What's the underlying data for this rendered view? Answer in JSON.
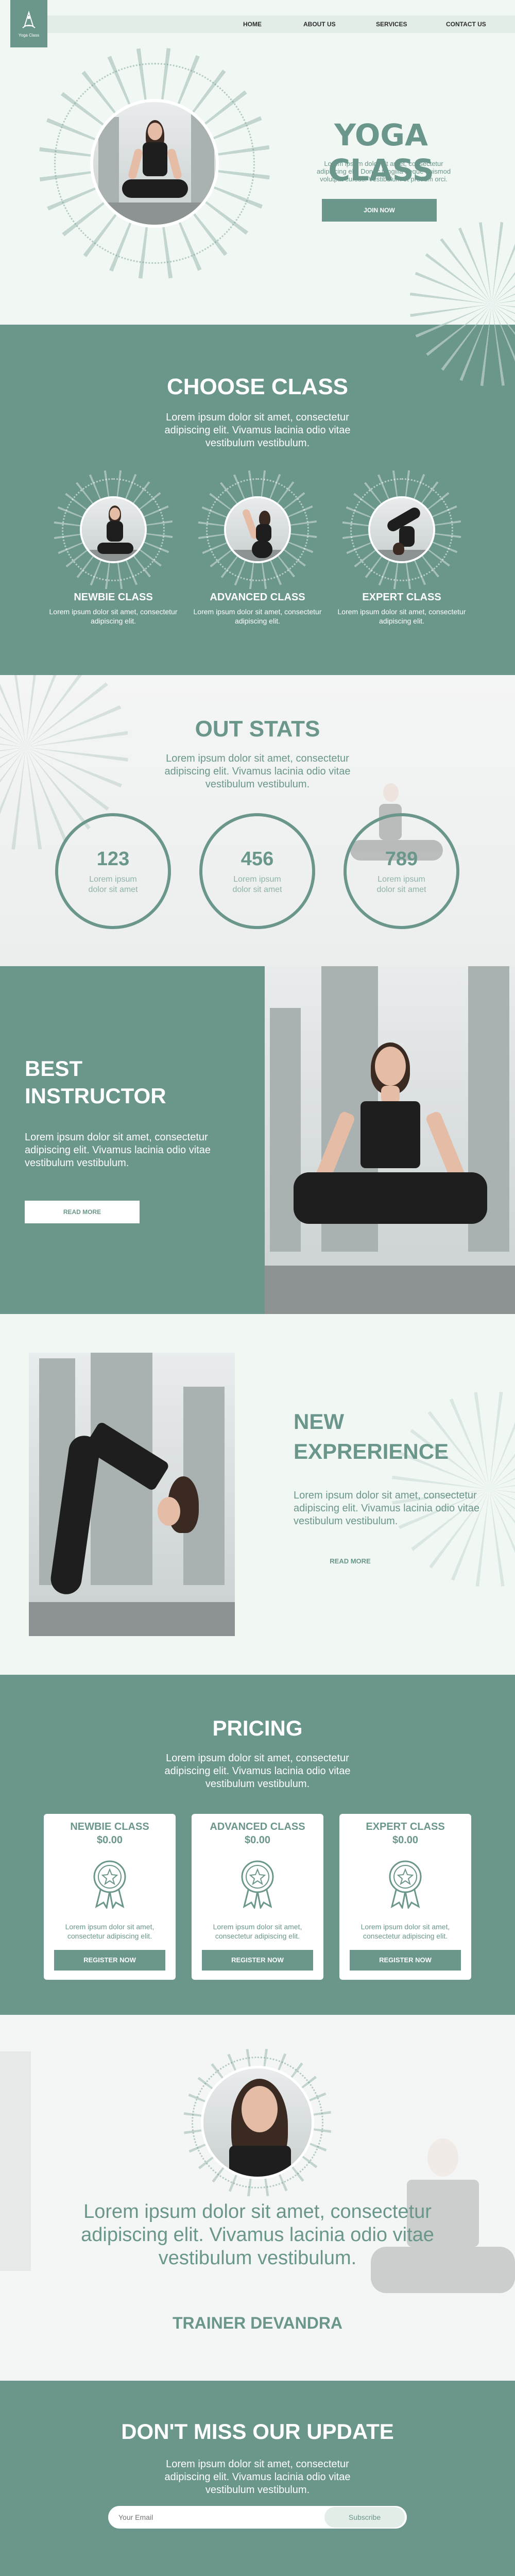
{
  "brand": {
    "logo_text": "Yoga Class",
    "accent": "#6a968b",
    "background": "#f1f7f3"
  },
  "nav": {
    "items": [
      "HOME",
      "ABOUT US",
      "SERVICES",
      "CONTACT US"
    ]
  },
  "hero": {
    "title": "YOGA CLASS",
    "text": "Lorem ipsum dolor sit amet, consectetur adipiscing elit. Donec fringilla neque euismod volutpat cursus. Vestibulum et pretium orci.",
    "button": "JOIN NOW"
  },
  "choose": {
    "title": "CHOOSE CLASS",
    "text": "Lorem ipsum dolor sit amet, consectetur adipiscing elit. Vivamus lacinia odio vitae vestibulum vestibulum.",
    "classes": [
      {
        "title": "NEWBIE CLASS",
        "text": "Lorem ipsum dolor sit amet, consectetur adipiscing elit."
      },
      {
        "title": "ADVANCED CLASS",
        "text": "Lorem ipsum dolor sit amet, consectetur adipiscing elit."
      },
      {
        "title": "EXPERT CLASS",
        "text": "Lorem ipsum dolor sit amet, consectetur adipiscing elit."
      }
    ]
  },
  "stats": {
    "title": "OUT STATS",
    "text": "Lorem ipsum dolor sit amet, consectetur adipiscing elit. Vivamus lacinia odio vitae vestibulum vestibulum.",
    "items": [
      {
        "value": "123",
        "label": "Lorem ipsum dolor sit amet"
      },
      {
        "value": "456",
        "label": "Lorem ipsum dolor sit amet"
      },
      {
        "value": "789",
        "label": "Lorem ipsum dolor sit amet"
      }
    ]
  },
  "instructor": {
    "title_line1": "BEST",
    "title_line2": "INSTRUCTOR",
    "text": "Lorem ipsum dolor sit amet, consectetur adipiscing elit. Vivamus lacinia odio vitae vestibulum vestibulum.",
    "button": "READ MORE"
  },
  "experience": {
    "title_line1": "NEW",
    "title_line2": "EXPRERIENCE",
    "text": "Lorem ipsum dolor sit amet, consectetur adipiscing elit. Vivamus lacinia odio vitae vestibulum vestibulum.",
    "button": "READ MORE"
  },
  "pricing": {
    "title": "PRICING",
    "text": "Lorem ipsum dolor sit amet, consectetur adipiscing elit. Vivamus lacinia odio vitae vestibulum vestibulum.",
    "plans": [
      {
        "title": "NEWBIE CLASS",
        "price": "$0.00",
        "text": "Lorem ipsum dolor sit amet, consectetur adipiscing elit.",
        "button": "REGISTER NOW"
      },
      {
        "title": "ADVANCED CLASS",
        "price": "$0.00",
        "text": "Lorem ipsum dolor sit amet, consectetur adipiscing elit.",
        "button": "REGISTER NOW"
      },
      {
        "title": "EXPERT CLASS",
        "price": "$0.00",
        "text": "Lorem ipsum dolor sit amet, consectetur adipiscing elit.",
        "button": "REGISTER NOW"
      }
    ]
  },
  "testimonial": {
    "quote": "Lorem ipsum dolor sit amet, consectetur adipiscing elit. Vivamus lacinia odio vitae vestibulum vestibulum.",
    "name": "TRAINER DEVANDRA"
  },
  "newsletter": {
    "title": "DON'T MISS OUR UPDATE",
    "text": "Lorem ipsum dolor sit amet, consectetur adipiscing elit. Vivamus lacinia odio vitae vestibulum vestibulum.",
    "placeholder": "Your Email",
    "button": "Subscribe"
  }
}
